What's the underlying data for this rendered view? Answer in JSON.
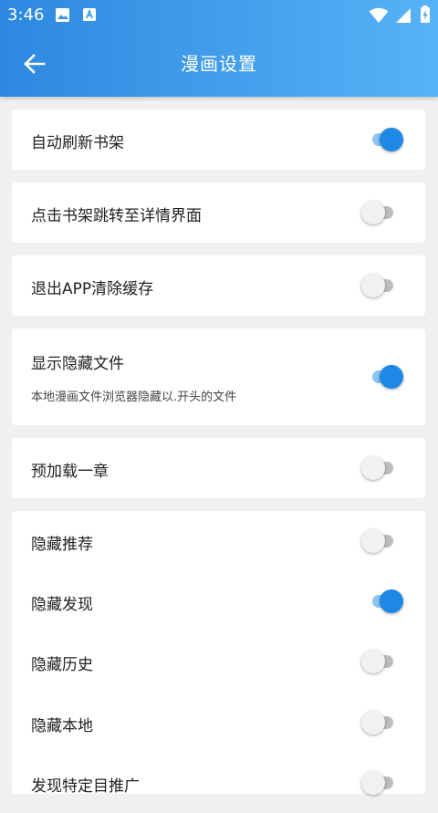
{
  "status_bar": {
    "time": "3:46",
    "icons": [
      "image-icon",
      "a-badge-icon",
      "wifi-icon",
      "signal-icon",
      "battery-charging-icon"
    ]
  },
  "header": {
    "title": "漫画设置",
    "back_icon": "arrow-back-icon"
  },
  "colors": {
    "accent": "#1e88e5",
    "appbar_start": "#2d88e0",
    "appbar_end": "#56b3f6"
  },
  "settings": [
    {
      "label": "自动刷新书架",
      "checked": true
    },
    {
      "label": "点击书架跳转至详情界面",
      "checked": false
    },
    {
      "label": "退出APP清除缓存",
      "checked": false
    },
    {
      "label": "显示隐藏文件",
      "subtitle": "本地漫画文件浏览器隐藏以.开头的文件",
      "checked": true
    },
    {
      "label": "预加载一章",
      "checked": false
    },
    {
      "label": "隐藏推荐",
      "checked": false
    },
    {
      "label": "隐藏发现",
      "checked": true
    },
    {
      "label": "隐藏历史",
      "checked": false
    },
    {
      "label": "隐藏本地",
      "checked": false
    },
    {
      "label": "发现特定目推广",
      "checked": false
    }
  ]
}
